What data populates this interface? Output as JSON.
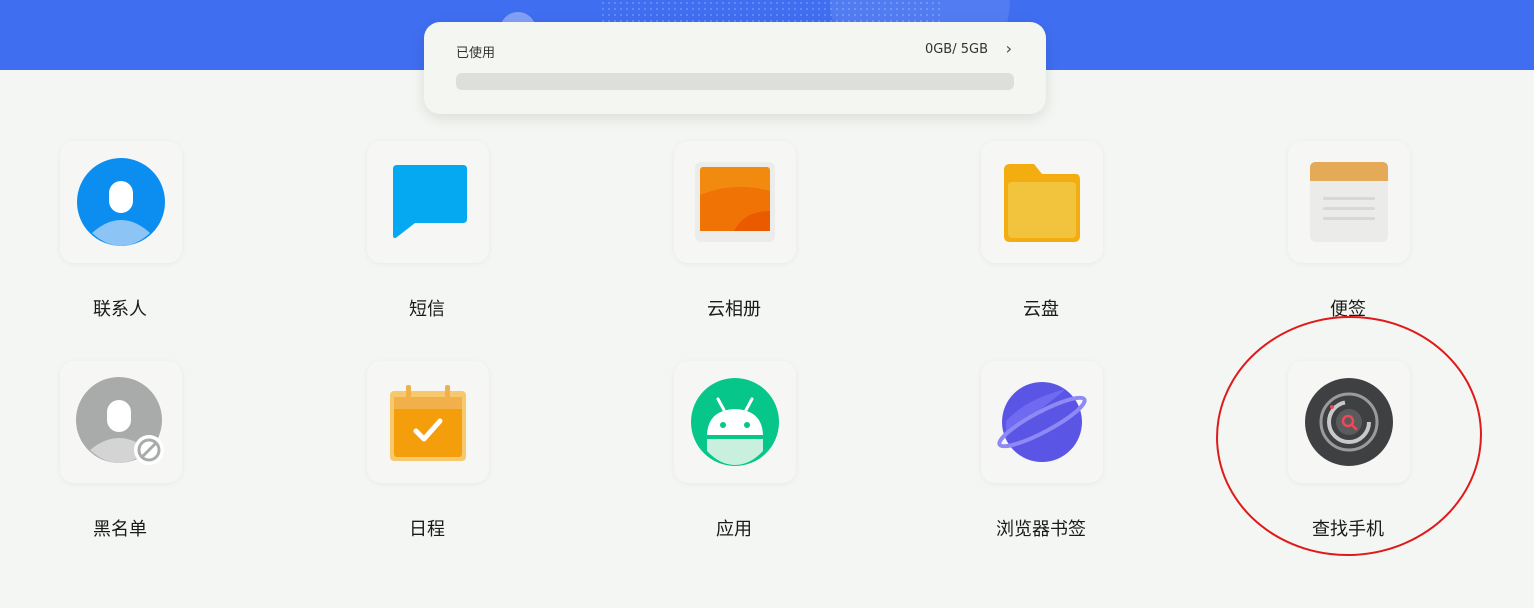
{
  "storage": {
    "label": "已使用",
    "value": "0GB/ 5GB",
    "chevron": "›",
    "used_fraction": 0
  },
  "apps": [
    {
      "label": "联系人",
      "icon": "contacts-icon"
    },
    {
      "label": "短信",
      "icon": "message-icon"
    },
    {
      "label": "云相册",
      "icon": "cloud-album-icon"
    },
    {
      "label": "云盘",
      "icon": "folder-icon"
    },
    {
      "label": "便签",
      "icon": "notes-icon"
    },
    {
      "label": "黑名单",
      "icon": "blacklist-icon"
    },
    {
      "label": "日程",
      "icon": "calendar-icon"
    },
    {
      "label": "应用",
      "icon": "android-icon"
    },
    {
      "label": "浏览器书签",
      "icon": "planet-icon"
    },
    {
      "label": "查找手机",
      "icon": "find-phone-icon"
    }
  ],
  "colors": {
    "header": "#3f6ef0",
    "highlight": "#e0191b"
  }
}
